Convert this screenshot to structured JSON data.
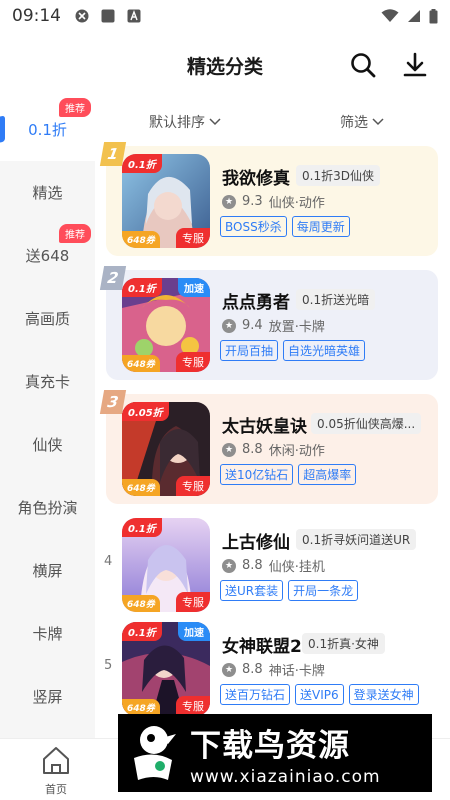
{
  "status_bar": {
    "time": "09:14"
  },
  "header": {
    "title": "精选分类"
  },
  "sidebar": {
    "items": [
      {
        "label": "0.1折",
        "badge": "推荐"
      },
      {
        "label": "精选"
      },
      {
        "label": "送648",
        "badge": "推荐"
      },
      {
        "label": "高画质"
      },
      {
        "label": "真充卡"
      },
      {
        "label": "仙侠"
      },
      {
        "label": "角色扮演"
      },
      {
        "label": "横屏"
      },
      {
        "label": "卡牌"
      },
      {
        "label": "竖屏"
      }
    ]
  },
  "sort": {
    "default": "默认排序",
    "filter": "筛选"
  },
  "games": [
    {
      "rank": "1",
      "name": "我欲修真",
      "subtitle": "0.1折3D仙侠",
      "rating": "9.3",
      "genre": "仙侠·动作",
      "tags": [
        "BOSS秒杀",
        "每周更新"
      ],
      "cover_tag": "0.1折",
      "cover_tag2": "",
      "cover_bl": "648券",
      "cover_br": "专服"
    },
    {
      "rank": "2",
      "name": "点点勇者",
      "subtitle": "0.1折送光暗",
      "rating": "9.4",
      "genre": "放置·卡牌",
      "tags": [
        "开局百抽",
        "自选光暗英雄"
      ],
      "cover_tag": "0.1折",
      "cover_tag2": "加速",
      "cover_bl": "648券",
      "cover_br": "专服"
    },
    {
      "rank": "3",
      "name": "太古妖皇诀",
      "subtitle": "0.05折仙侠高爆...",
      "rating": "8.8",
      "genre": "休闲·动作",
      "tags": [
        "送10亿钻石",
        "超高爆率"
      ],
      "cover_tag": "0.05折",
      "cover_tag2": "",
      "cover_bl": "648券",
      "cover_br": "专服"
    },
    {
      "rank": "4",
      "name": "上古修仙",
      "subtitle": "0.1折寻妖问道送UR",
      "rating": "8.8",
      "genre": "仙侠·挂机",
      "tags": [
        "送UR套装",
        "开局一条龙"
      ],
      "cover_tag": "0.1折",
      "cover_tag2": "",
      "cover_bl": "648券",
      "cover_br": "专服"
    },
    {
      "rank": "5",
      "name": "女神联盟2",
      "subtitle": "0.1折真·女神",
      "rating": "8.8",
      "genre": "神话·卡牌",
      "tags": [
        "送百万钻石",
        "送VIP6",
        "登录送女神"
      ],
      "cover_tag": "0.1折",
      "cover_tag2": "加速",
      "cover_bl": "648券",
      "cover_br": "专服"
    }
  ],
  "bottom_nav": {
    "home_label": "首页"
  },
  "watermark": {
    "brand": "下载鸟资源",
    "url": "www.xiazainiao.com"
  },
  "colors": {
    "accent": "#2f7cf6",
    "red": "#ef2f2f"
  }
}
